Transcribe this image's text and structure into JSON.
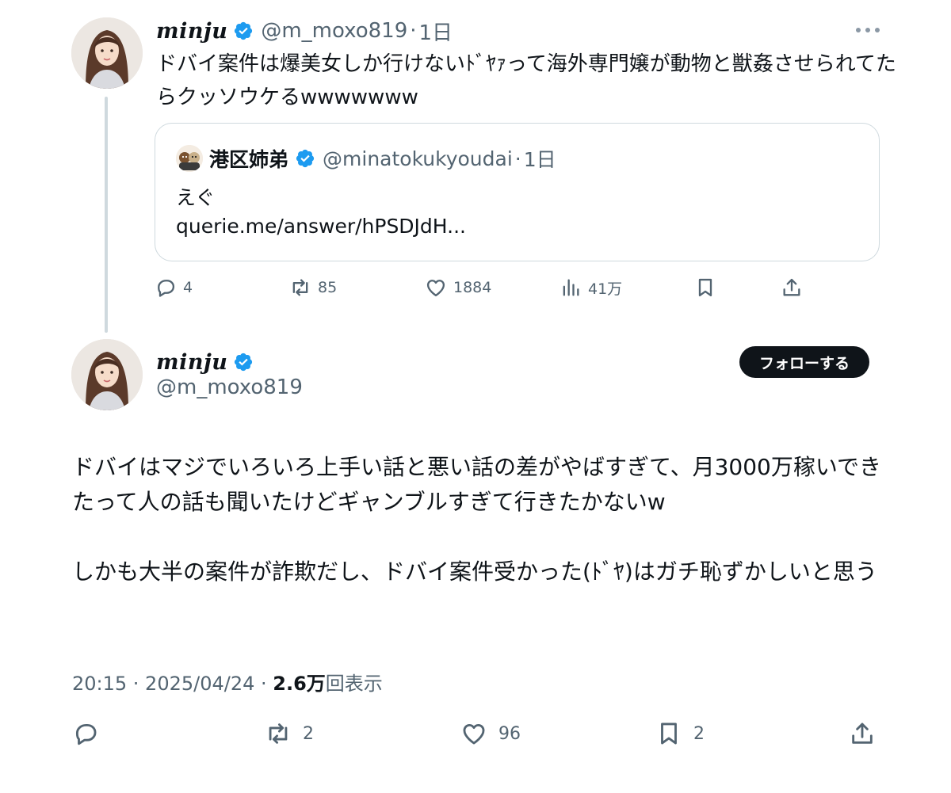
{
  "parent_tweet": {
    "display_name": "minju",
    "handle": "@m_moxo819",
    "separator": "·",
    "time": "1日",
    "text": "ドバイ案件は爆美女しか行けないﾄﾞﾔｧって海外専門嬢が動物と獣姦させられてたらクッソウケるwwwwwww",
    "quote": {
      "display_name": "港区姉弟",
      "handle": "@minatokukyoudai",
      "separator": "·",
      "time": "1日",
      "line1": "えぐ",
      "line2": "querie.me/answer/hPSDJdH..."
    },
    "actions": {
      "replies": "4",
      "reposts": "85",
      "likes": "1884",
      "views": "41万"
    }
  },
  "main_tweet": {
    "display_name": "minju",
    "handle": "@m_moxo819",
    "follow_label": "フォローする",
    "paragraph1": "ドバイはマジでいろいろ上手い話と悪い話の差がやばすぎて、月3000万稼いできたって人の話も聞いたけどギャンブルすぎて行きたかないw",
    "paragraph2": "しかも大半の案件が詐欺だし、ドバイ案件受かった(ﾄﾞﾔ)はガチ恥ずかしいと思う",
    "timestamp": "20:15 · 2025/04/24 · ",
    "views_count": "2.6万",
    "views_label": "回表示",
    "actions": {
      "reposts": "2",
      "likes": "96",
      "bookmarks": "2"
    }
  },
  "colors": {
    "verified_blue": "#1d9bf0",
    "text_primary": "#0f1419",
    "text_secondary": "#536471",
    "border": "#cfd9de",
    "follow_button_bg": "#0f1419"
  },
  "icons": {
    "reply": "reply-icon",
    "repost": "repost-icon",
    "like": "heart-icon",
    "views": "views-chart-icon",
    "bookmark": "bookmark-icon",
    "share": "share-icon",
    "verified": "verified-badge-icon",
    "more": "more-dots-icon"
  }
}
